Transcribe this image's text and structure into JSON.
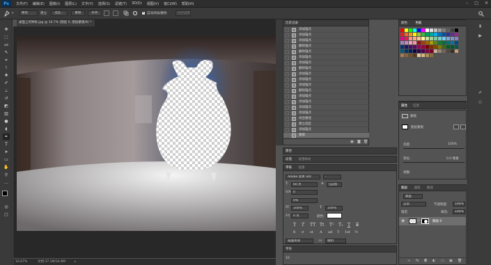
{
  "app": {
    "logo": "Ps"
  },
  "menubar": {
    "items": [
      "文件(F)",
      "编辑(E)",
      "图像(I)",
      "图层(L)",
      "文字(Y)",
      "选择(S)",
      "滤镜(T)",
      "3D(D)",
      "视图(V)",
      "窗口(W)",
      "帮助(H)"
    ],
    "window_controls": [
      "minimize-icon",
      "maximize-icon",
      "close-icon"
    ]
  },
  "options": {
    "tool_icon": "pen-icon",
    "mode_value": "路径",
    "make_label": "建立:",
    "make_selection_button": "选区...",
    "mask_button": "蒙版",
    "shape_button": "形状",
    "auto_add_delete_label": "自动添加/删除",
    "align_edges_label": "对齐边缘",
    "auto_add_checked": true
  },
  "document": {
    "tab_title": "桌面上的钟表.jpg @ 16.7% (图层 0, 图层蒙版/8) *",
    "zoom": "16.67%",
    "doc_info": "文档:37.1M/34.8M"
  },
  "history": {
    "title": "历史记录",
    "items": [
      "添加锚点",
      "添加锚点",
      "添加锚点",
      "删除锚点",
      "删除锚点",
      "添加锚点",
      "添加锚点",
      "删除锚点",
      "添加锚点",
      "添加锚点",
      "添加锚点",
      "删除锚点",
      "添加锚点",
      "添加锚点",
      "添加锚点",
      "添加锚点",
      "闭合路径",
      "建立选区",
      "添加锚点",
      "蒙版"
    ],
    "selected_index": 19
  },
  "swatches": {
    "tabs": [
      "颜色",
      "色板"
    ],
    "colors": [
      "#ff0000",
      "#ffff00",
      "#00ff00",
      "#00ffff",
      "#0000ff",
      "#ff00ff",
      "#ffffff",
      "#e0e0e0",
      "#c0c0c0",
      "#a0a0a0",
      "#808080",
      "#606060",
      "#404040",
      "#000000",
      "#ed1c24",
      "#f26522",
      "#f7941d",
      "#fff200",
      "#8dc63f",
      "#39b54a",
      "#00a651",
      "#00a99d",
      "#00aeef",
      "#0072bc",
      "#0054a6",
      "#2e3192",
      "#662d91",
      "#92278f",
      "#ec008c",
      "#ed145b",
      "#f7977a",
      "#f9ad81",
      "#fdc68a",
      "#fff79a",
      "#c4df9b",
      "#a3d39c",
      "#82ca9d",
      "#7bcdc8",
      "#6dcff6",
      "#7da7d9",
      "#8393ca",
      "#8882be",
      "#a187be",
      "#bc8dbf",
      "#f49ac2",
      "#f6989d",
      "#9e0b0f",
      "#a0410d",
      "#a36209",
      "#aba000",
      "#598527",
      "#1a7b30",
      "#007236",
      "#00746b",
      "#0076a3",
      "#004b80",
      "#003471",
      "#1b1464",
      "#440e62",
      "#630460",
      "#9e005d",
      "#9e0039",
      "#790000",
      "#7b2e00",
      "#7d4900",
      "#827b00",
      "#406618",
      "#005e20",
      "#005826",
      "#005952",
      "#005b7f",
      "#003663",
      "#002157",
      "#0d004c",
      "#32004b",
      "#4b0049",
      "#7b0046",
      "#7a0026",
      "#c7b299",
      "#998675",
      "#736357",
      "#534741",
      "#37302a",
      "#c69c6d",
      "#a67c52",
      "#8c6239",
      "#754c24",
      "#603913",
      "#e0c8a0",
      "#d4b483",
      "#b08d57",
      "#8a6d3b"
    ]
  },
  "adjustments": {
    "tabs": [
      "调整",
      "样式"
    ]
  },
  "properties": {
    "tabs": [
      "属性",
      "信息"
    ],
    "title": "蒙版",
    "layer_mask_label": "图层蒙版",
    "density_label": "浓度:",
    "density_value": "100%",
    "feather_label": "羽化:",
    "feather_value": "0.0 像素",
    "refine_label": "调整:",
    "mask_edge_button": "蒙版边缘...",
    "color_range_button": "颜色范围...",
    "invert_button": "反相"
  },
  "paths_panel": {
    "title": "路径"
  },
  "paragraph": {
    "tabs": [
      "段落",
      "段落样式"
    ]
  },
  "character": {
    "tabs": [
      "字符",
      "段落"
    ],
    "font_family": "Adobe 黑体 Std",
    "font_style": "-",
    "font_size": "60 点",
    "leading": "(自动)",
    "kerning": "0",
    "tracking": "0%",
    "vertical_scale": "100%",
    "horizontal_scale": "100%",
    "baseline_shift": "0 点",
    "color_label": "颜色:",
    "format_buttons": [
      "T",
      "T",
      "TT",
      "Tt",
      "T¹",
      "T₁",
      "T",
      "T"
    ],
    "opentype_buttons": [
      "fi",
      "σ",
      "st",
      "A",
      "ad",
      "T",
      "1st",
      "½"
    ],
    "language": "美国英语",
    "antialias": "锐利"
  },
  "layers": {
    "tabs": [
      "图层",
      "通道",
      "路径"
    ],
    "filter_kind": "类型",
    "blend_mode": "正常",
    "opacity_label": "不透明度:",
    "opacity_value": "100%",
    "lock_label": "锁定:",
    "fill_label": "填充:",
    "fill_value": "100%",
    "layer_name": "图层 0",
    "footer_icons": [
      "link-icon",
      "fx-icon",
      "mask-icon",
      "adjustment-icon",
      "group-icon",
      "new-layer-icon",
      "trash-icon"
    ]
  },
  "bottom_panel": {
    "title": "字符",
    "value": "10"
  }
}
